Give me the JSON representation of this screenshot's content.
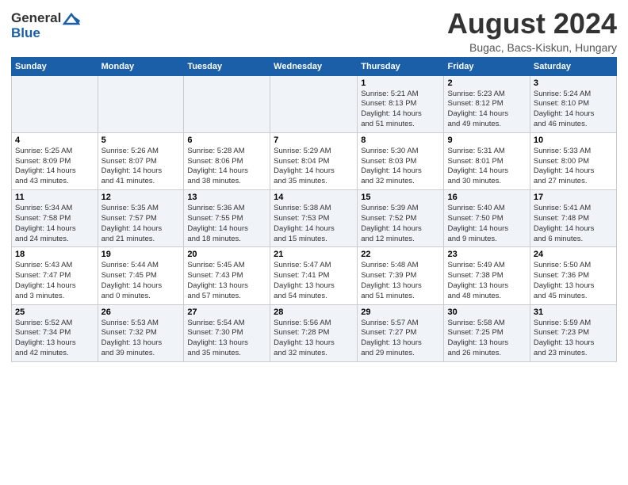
{
  "header": {
    "logo_line1": "General",
    "logo_line2": "Blue",
    "title": "August 2024",
    "subtitle": "Bugac, Bacs-Kiskun, Hungary"
  },
  "weekdays": [
    "Sunday",
    "Monday",
    "Tuesday",
    "Wednesday",
    "Thursday",
    "Friday",
    "Saturday"
  ],
  "weeks": [
    [
      {
        "day": "",
        "info": ""
      },
      {
        "day": "",
        "info": ""
      },
      {
        "day": "",
        "info": ""
      },
      {
        "day": "",
        "info": ""
      },
      {
        "day": "1",
        "info": "Sunrise: 5:21 AM\nSunset: 8:13 PM\nDaylight: 14 hours\nand 51 minutes."
      },
      {
        "day": "2",
        "info": "Sunrise: 5:23 AM\nSunset: 8:12 PM\nDaylight: 14 hours\nand 49 minutes."
      },
      {
        "day": "3",
        "info": "Sunrise: 5:24 AM\nSunset: 8:10 PM\nDaylight: 14 hours\nand 46 minutes."
      }
    ],
    [
      {
        "day": "4",
        "info": "Sunrise: 5:25 AM\nSunset: 8:09 PM\nDaylight: 14 hours\nand 43 minutes."
      },
      {
        "day": "5",
        "info": "Sunrise: 5:26 AM\nSunset: 8:07 PM\nDaylight: 14 hours\nand 41 minutes."
      },
      {
        "day": "6",
        "info": "Sunrise: 5:28 AM\nSunset: 8:06 PM\nDaylight: 14 hours\nand 38 minutes."
      },
      {
        "day": "7",
        "info": "Sunrise: 5:29 AM\nSunset: 8:04 PM\nDaylight: 14 hours\nand 35 minutes."
      },
      {
        "day": "8",
        "info": "Sunrise: 5:30 AM\nSunset: 8:03 PM\nDaylight: 14 hours\nand 32 minutes."
      },
      {
        "day": "9",
        "info": "Sunrise: 5:31 AM\nSunset: 8:01 PM\nDaylight: 14 hours\nand 30 minutes."
      },
      {
        "day": "10",
        "info": "Sunrise: 5:33 AM\nSunset: 8:00 PM\nDaylight: 14 hours\nand 27 minutes."
      }
    ],
    [
      {
        "day": "11",
        "info": "Sunrise: 5:34 AM\nSunset: 7:58 PM\nDaylight: 14 hours\nand 24 minutes."
      },
      {
        "day": "12",
        "info": "Sunrise: 5:35 AM\nSunset: 7:57 PM\nDaylight: 14 hours\nand 21 minutes."
      },
      {
        "day": "13",
        "info": "Sunrise: 5:36 AM\nSunset: 7:55 PM\nDaylight: 14 hours\nand 18 minutes."
      },
      {
        "day": "14",
        "info": "Sunrise: 5:38 AM\nSunset: 7:53 PM\nDaylight: 14 hours\nand 15 minutes."
      },
      {
        "day": "15",
        "info": "Sunrise: 5:39 AM\nSunset: 7:52 PM\nDaylight: 14 hours\nand 12 minutes."
      },
      {
        "day": "16",
        "info": "Sunrise: 5:40 AM\nSunset: 7:50 PM\nDaylight: 14 hours\nand 9 minutes."
      },
      {
        "day": "17",
        "info": "Sunrise: 5:41 AM\nSunset: 7:48 PM\nDaylight: 14 hours\nand 6 minutes."
      }
    ],
    [
      {
        "day": "18",
        "info": "Sunrise: 5:43 AM\nSunset: 7:47 PM\nDaylight: 14 hours\nand 3 minutes."
      },
      {
        "day": "19",
        "info": "Sunrise: 5:44 AM\nSunset: 7:45 PM\nDaylight: 14 hours\nand 0 minutes."
      },
      {
        "day": "20",
        "info": "Sunrise: 5:45 AM\nSunset: 7:43 PM\nDaylight: 13 hours\nand 57 minutes."
      },
      {
        "day": "21",
        "info": "Sunrise: 5:47 AM\nSunset: 7:41 PM\nDaylight: 13 hours\nand 54 minutes."
      },
      {
        "day": "22",
        "info": "Sunrise: 5:48 AM\nSunset: 7:39 PM\nDaylight: 13 hours\nand 51 minutes."
      },
      {
        "day": "23",
        "info": "Sunrise: 5:49 AM\nSunset: 7:38 PM\nDaylight: 13 hours\nand 48 minutes."
      },
      {
        "day": "24",
        "info": "Sunrise: 5:50 AM\nSunset: 7:36 PM\nDaylight: 13 hours\nand 45 minutes."
      }
    ],
    [
      {
        "day": "25",
        "info": "Sunrise: 5:52 AM\nSunset: 7:34 PM\nDaylight: 13 hours\nand 42 minutes."
      },
      {
        "day": "26",
        "info": "Sunrise: 5:53 AM\nSunset: 7:32 PM\nDaylight: 13 hours\nand 39 minutes."
      },
      {
        "day": "27",
        "info": "Sunrise: 5:54 AM\nSunset: 7:30 PM\nDaylight: 13 hours\nand 35 minutes."
      },
      {
        "day": "28",
        "info": "Sunrise: 5:56 AM\nSunset: 7:28 PM\nDaylight: 13 hours\nand 32 minutes."
      },
      {
        "day": "29",
        "info": "Sunrise: 5:57 AM\nSunset: 7:27 PM\nDaylight: 13 hours\nand 29 minutes."
      },
      {
        "day": "30",
        "info": "Sunrise: 5:58 AM\nSunset: 7:25 PM\nDaylight: 13 hours\nand 26 minutes."
      },
      {
        "day": "31",
        "info": "Sunrise: 5:59 AM\nSunset: 7:23 PM\nDaylight: 13 hours\nand 23 minutes."
      }
    ]
  ]
}
